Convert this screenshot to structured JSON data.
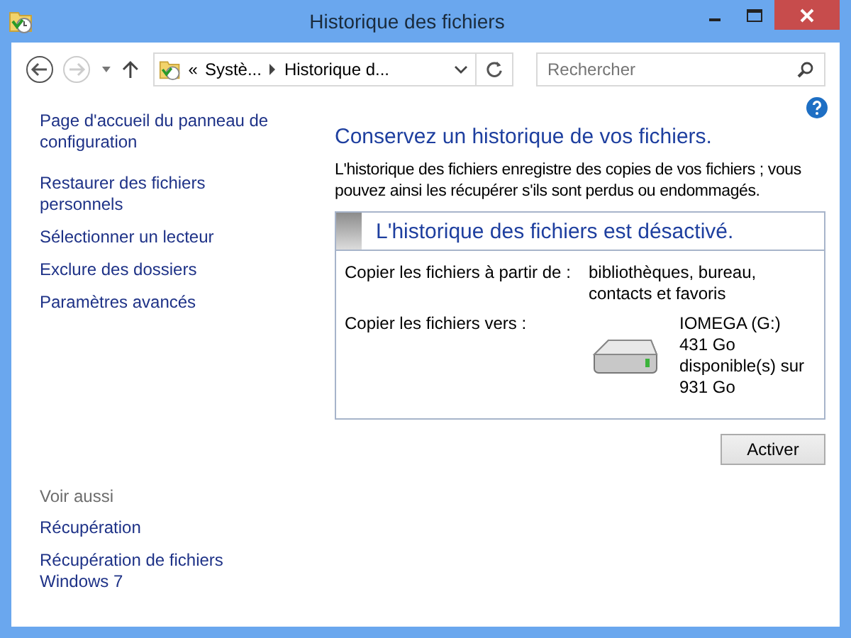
{
  "window": {
    "title": "Historique des fichiers"
  },
  "navigation": {
    "back_disabled": false,
    "forward_disabled": true,
    "breadcrumb": [
      {
        "label": "«"
      },
      {
        "label": "Systè..."
      },
      {
        "label": "Historique d..."
      }
    ],
    "search": {
      "placeholder": "Rechercher"
    }
  },
  "sidebar": {
    "links": [
      {
        "label": "Page d'accueil du panneau de configuration"
      },
      {
        "label": "Restaurer des fichiers personnels"
      },
      {
        "label": "Sélectionner un lecteur"
      },
      {
        "label": "Exclure des dossiers"
      },
      {
        "label": "Paramètres avancés"
      }
    ],
    "see_also": {
      "heading": "Voir aussi",
      "links": [
        {
          "label": "Récupération"
        },
        {
          "label": "Récupération de fichiers Windows 7"
        }
      ]
    }
  },
  "main": {
    "heading": "Conservez un historique de vos fichiers.",
    "description": "L'historique des fichiers enregistre des copies de vos fichiers ; vous pouvez ainsi les récupérer s'ils sont perdus ou endommagés.",
    "status": {
      "title": "L'historique des fichiers est désactivé.",
      "enabled": false
    },
    "copy_from": {
      "label": "Copier les fichiers à partir de :",
      "value": "bibliothèques, bureau, contacts et favoris"
    },
    "copy_to": {
      "label": "Copier les fichiers vers :",
      "drive_name": "IOMEGA (G:)",
      "drive_space": "431 Go disponible(s) sur 931 Go"
    },
    "button": "Activer"
  }
}
